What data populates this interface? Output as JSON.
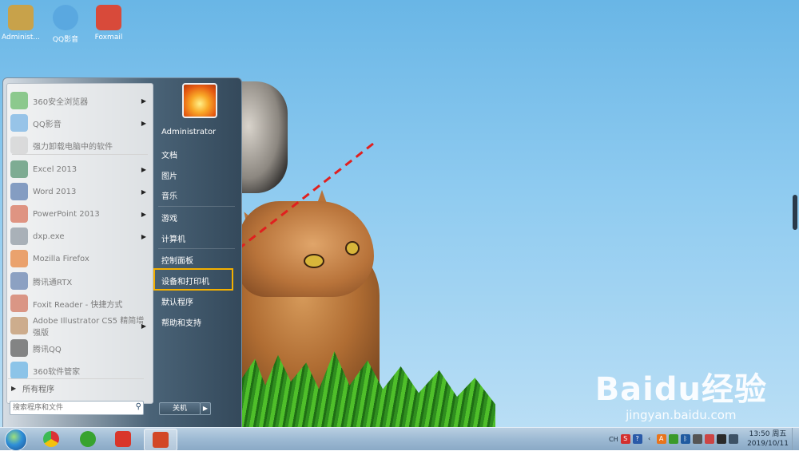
{
  "desktop": {
    "icons": [
      {
        "label": "Administ...",
        "name": "desktop-icon-administrator",
        "color": "#c8a24a"
      },
      {
        "label": "QQ影音",
        "name": "desktop-icon-qq-player",
        "color": "#5aa8e0"
      },
      {
        "label": "Foxmail",
        "name": "desktop-icon-foxmail",
        "color": "#d84a3a"
      }
    ],
    "watermark": {
      "brand": "Baidu经验",
      "url": "jingyan.baidu.com"
    }
  },
  "start_menu": {
    "programs": [
      {
        "label": "360安全浏览器",
        "icon": "360-browser-icon",
        "color": "#3aa83a",
        "submenu": true
      },
      {
        "label": "QQ影音",
        "icon": "qq-player-icon",
        "color": "#4e9ee0",
        "submenu": true
      },
      {
        "label": "强力卸载电脑中的软件",
        "icon": "uninstaller-icon",
        "color": "#c9c9c9",
        "submenu": false
      },
      {
        "label": "Excel 2013",
        "icon": "excel-icon",
        "color": "#217346",
        "submenu": true
      },
      {
        "label": "Word 2013",
        "icon": "word-icon",
        "color": "#2b579a",
        "submenu": true
      },
      {
        "label": "PowerPoint 2013",
        "icon": "powerpoint-icon",
        "color": "#d24726",
        "submenu": true
      },
      {
        "label": "dxp.exe",
        "icon": "dxp-icon",
        "color": "#6f7c88",
        "submenu": true
      },
      {
        "label": "Mozilla Firefox",
        "icon": "firefox-icon",
        "color": "#e66000",
        "submenu": false
      },
      {
        "label": "腾讯通RTX",
        "icon": "rtx-icon",
        "color": "#3a5f9a",
        "submenu": false
      },
      {
        "label": "Foxit Reader - 快捷方式",
        "icon": "foxit-reader-icon",
        "color": "#c84b2b",
        "submenu": false
      },
      {
        "label": "Adobe Illustrator CS5 精简增强版",
        "icon": "illustrator-icon",
        "color": "#b0753a",
        "submenu": true
      },
      {
        "label": "腾讯QQ",
        "icon": "qq-icon",
        "color": "#2a2a2a",
        "submenu": false
      },
      {
        "label": "360软件管家",
        "icon": "360-software-manager-icon",
        "color": "#3a9ee0",
        "submenu": false
      }
    ],
    "all_programs": "所有程序",
    "search_placeholder": "搜索程序和文件",
    "user_name": "Administrator",
    "right_items": [
      {
        "label": "文档",
        "name": "menu-documents"
      },
      {
        "label": "图片",
        "name": "menu-pictures"
      },
      {
        "label": "音乐",
        "name": "menu-music"
      },
      {
        "label": "游戏",
        "name": "menu-games"
      },
      {
        "label": "计算机",
        "name": "menu-computer"
      },
      {
        "label": "控制面板",
        "name": "menu-control-panel"
      },
      {
        "label": "设备和打印机",
        "name": "menu-devices-and-printers"
      },
      {
        "label": "默认程序",
        "name": "menu-default-programs"
      },
      {
        "label": "帮助和支持",
        "name": "menu-help-and-support"
      }
    ],
    "shutdown_label": "关机",
    "highlighted_item": "设备和打印机",
    "highlight_color": "#f4b000"
  },
  "annotation": {
    "arrow_color": "#e0201f"
  },
  "taskbar": {
    "pinned": [
      {
        "name": "taskbar-chrome",
        "icon": "chrome-icon",
        "color": "#e0b52a"
      },
      {
        "name": "taskbar-360-browser",
        "icon": "360-browser-icon",
        "color": "#37a32f"
      },
      {
        "name": "taskbar-foxmail",
        "icon": "foxmail-icon",
        "color": "#d9362a"
      },
      {
        "name": "taskbar-powerpoint",
        "icon": "powerpoint-icon",
        "color": "#d24726",
        "active": true
      }
    ],
    "tray": {
      "ime": "CH",
      "time": "13:50 周五",
      "date": "2019/10/11"
    }
  }
}
